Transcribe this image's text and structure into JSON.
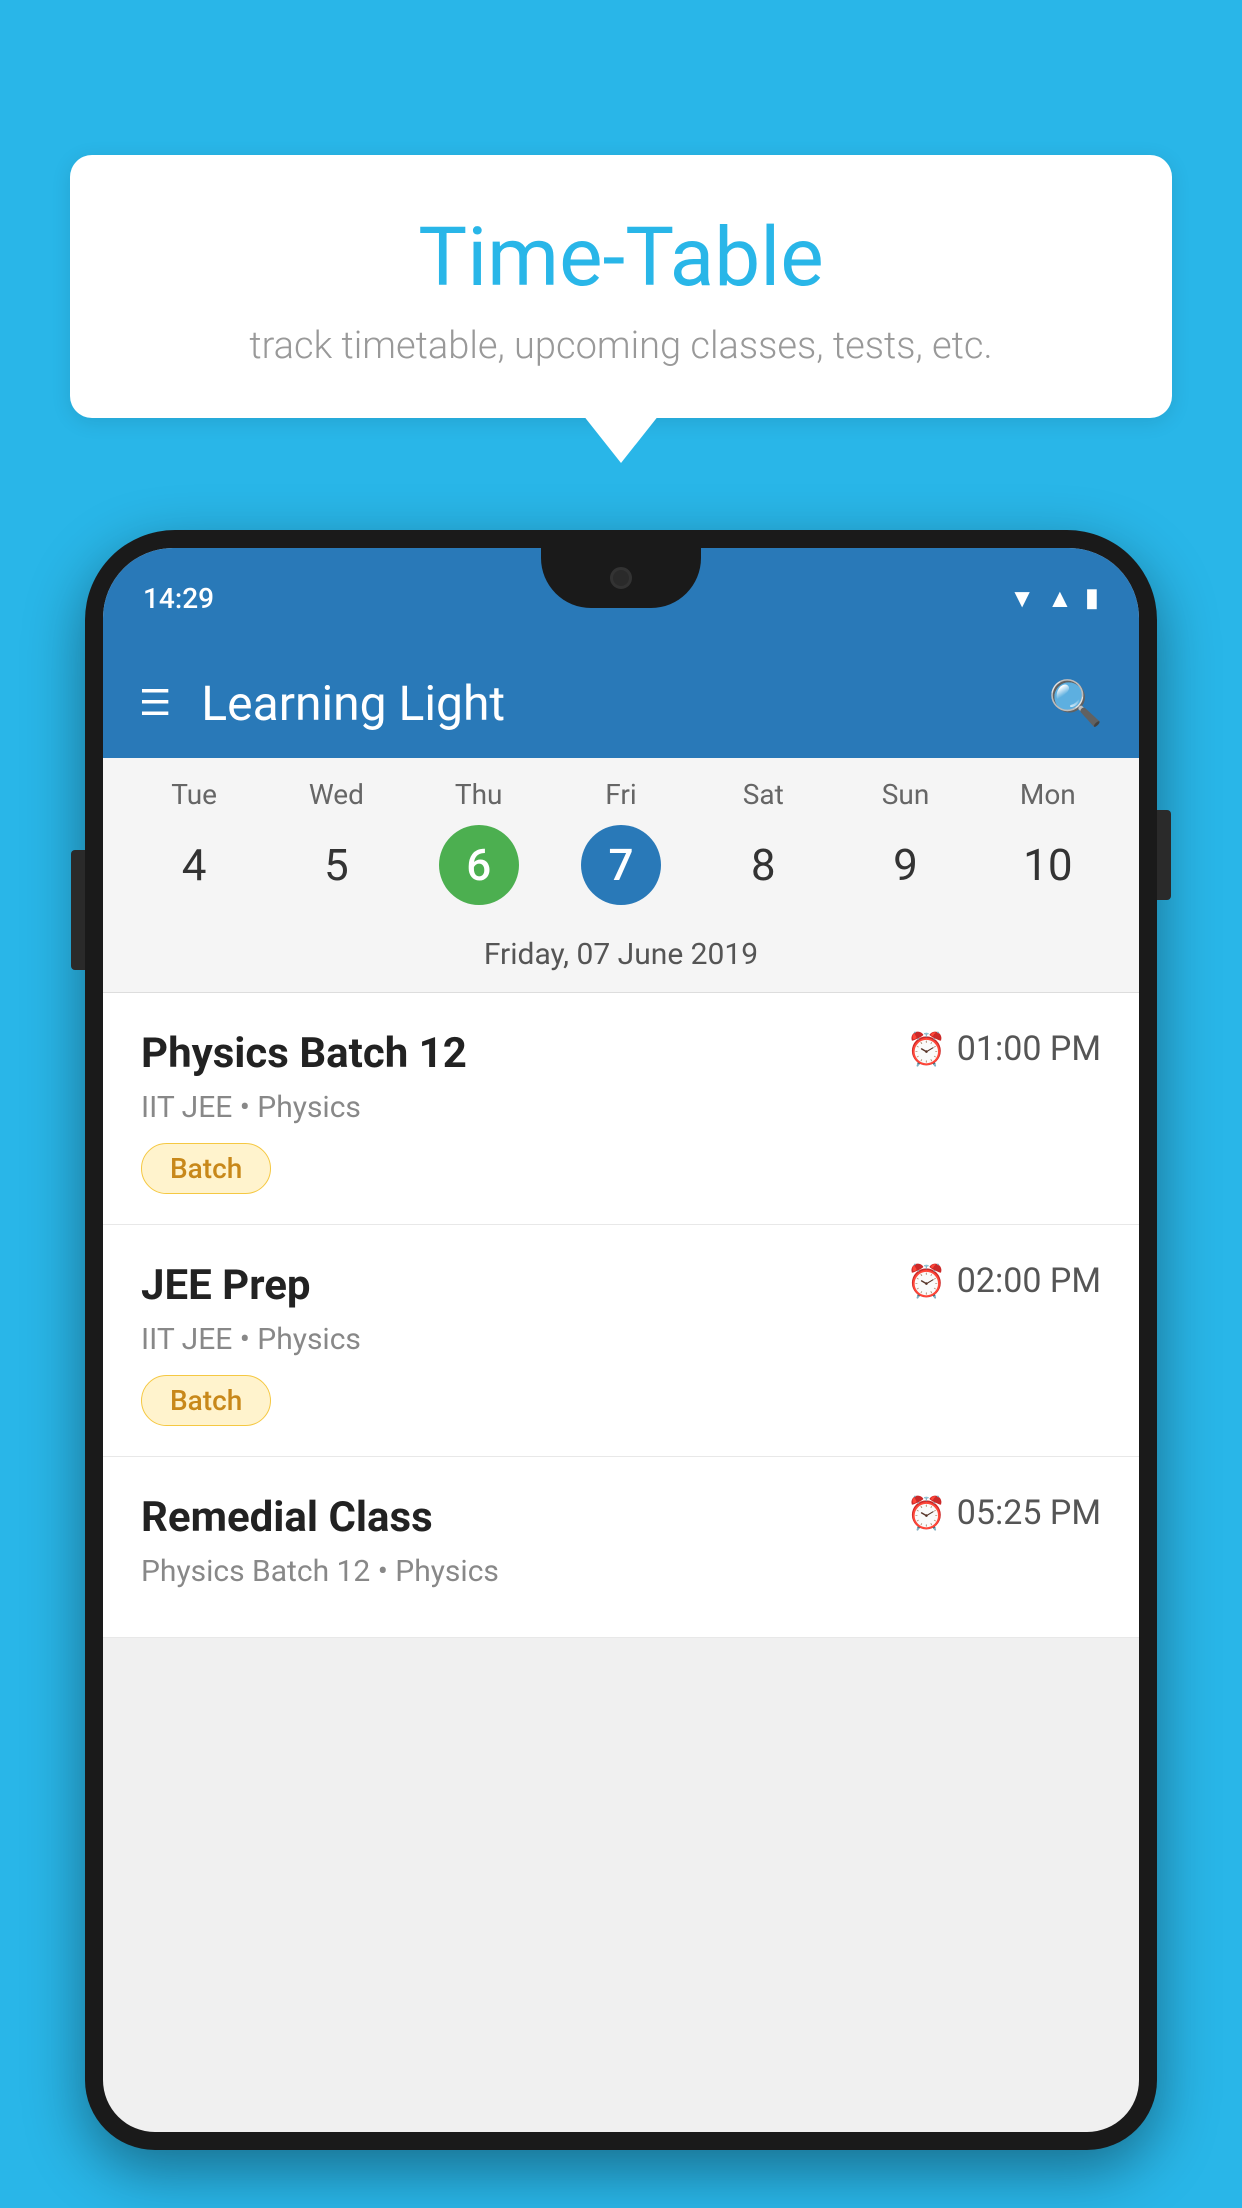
{
  "background_color": "#29B6E8",
  "speech_bubble": {
    "title": "Time-Table",
    "subtitle": "track timetable, upcoming classes, tests, etc."
  },
  "phone": {
    "status_bar": {
      "time": "14:29"
    },
    "app_header": {
      "title": "Learning Light"
    },
    "calendar": {
      "days": [
        {
          "name": "Tue",
          "number": "4",
          "state": "normal"
        },
        {
          "name": "Wed",
          "number": "5",
          "state": "normal"
        },
        {
          "name": "Thu",
          "number": "6",
          "state": "today"
        },
        {
          "name": "Fri",
          "number": "7",
          "state": "selected"
        },
        {
          "name": "Sat",
          "number": "8",
          "state": "normal"
        },
        {
          "name": "Sun",
          "number": "9",
          "state": "normal"
        },
        {
          "name": "Mon",
          "number": "10",
          "state": "normal"
        }
      ],
      "selected_date_label": "Friday, 07 June 2019"
    },
    "schedule": [
      {
        "title": "Physics Batch 12",
        "time": "01:00 PM",
        "sub": "IIT JEE • Physics",
        "tag": "Batch"
      },
      {
        "title": "JEE Prep",
        "time": "02:00 PM",
        "sub": "IIT JEE • Physics",
        "tag": "Batch"
      },
      {
        "title": "Remedial Class",
        "time": "05:25 PM",
        "sub": "Physics Batch 12 • Physics",
        "tag": null
      }
    ]
  }
}
